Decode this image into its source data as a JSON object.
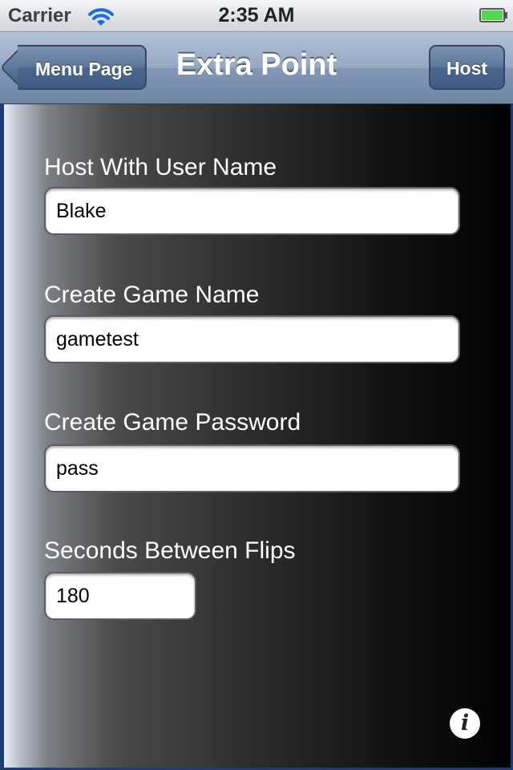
{
  "status_bar": {
    "carrier": "Carrier",
    "time": "2:35 AM",
    "wifi_icon": "wifi-icon",
    "battery_icon": "battery-icon",
    "battery_color": "#4cd94c"
  },
  "nav_bar": {
    "back_label": "Menu Page",
    "title": "Extra Point",
    "right_button_label": "Host",
    "tint_color": "#6e86a7"
  },
  "form": {
    "user_name_label": "Host With User Name",
    "user_name_value": "Blake",
    "game_name_label": "Create Game Name",
    "game_name_value": "gametest",
    "game_password_label": "Create Game Password",
    "game_password_value": "pass",
    "seconds_label": "Seconds Between Flips",
    "seconds_value": "180"
  },
  "info_button": {
    "icon": "info-icon",
    "glyph": "i"
  }
}
